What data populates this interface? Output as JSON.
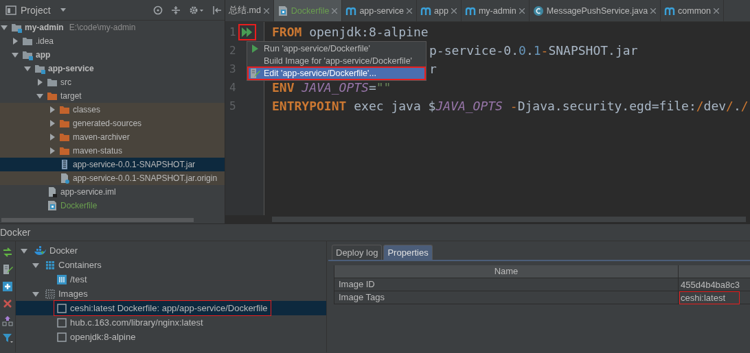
{
  "project_panel": {
    "title": "Project",
    "tree": [
      {
        "label": "my-admin",
        "kind": "module",
        "path": "E:\\code\\my-admin",
        "expanded": true,
        "selected": false,
        "children": [
          {
            "label": ".idea",
            "kind": "folder",
            "expanded": false,
            "selected": false
          },
          {
            "label": "app",
            "kind": "module",
            "expanded": true,
            "selected": false,
            "children": [
              {
                "label": "app-service",
                "kind": "module",
                "expanded": true,
                "selected": false,
                "children": [
                  {
                    "label": "src",
                    "kind": "folder",
                    "expanded": false,
                    "selected": false
                  },
                  {
                    "label": "target",
                    "kind": "excluded-folder",
                    "expanded": true,
                    "selected": false,
                    "children": [
                      {
                        "label": "classes",
                        "kind": "excluded-folder",
                        "expanded": false,
                        "selected": false
                      },
                      {
                        "label": "generated-sources",
                        "kind": "excluded-folder",
                        "expanded": false,
                        "selected": false
                      },
                      {
                        "label": "maven-archiver",
                        "kind": "excluded-folder",
                        "expanded": false,
                        "selected": false
                      },
                      {
                        "label": "maven-status",
                        "kind": "excluded-folder",
                        "expanded": false,
                        "selected": false
                      },
                      {
                        "label": "app-service-0.0.1-SNAPSHOT.jar",
                        "kind": "jar",
                        "selected": true
                      },
                      {
                        "label": "app-service-0.0.1-SNAPSHOT.jar.origin",
                        "kind": "unknown",
                        "selected": false
                      }
                    ]
                  },
                  {
                    "label": "app-service.iml",
                    "kind": "iml",
                    "selected": false
                  },
                  {
                    "label": "Dockerfile",
                    "kind": "dockerfile",
                    "selected": false
                  }
                ]
              }
            ]
          }
        ]
      }
    ]
  },
  "editor": {
    "tabs": [
      {
        "label": "总结.md",
        "kind": "markdown",
        "selected": false
      },
      {
        "label": "Dockerfile",
        "kind": "dockerfile",
        "selected": true
      },
      {
        "label": "app-service",
        "kind": "maven",
        "selected": false
      },
      {
        "label": "app",
        "kind": "maven",
        "selected": false
      },
      {
        "label": "my-admin",
        "kind": "maven",
        "selected": false
      },
      {
        "label": "MessagePushService.java",
        "kind": "class",
        "selected": false
      },
      {
        "label": "common",
        "kind": "maven",
        "selected": false
      }
    ],
    "run_gutter": {
      "highlighted": true
    },
    "lines": [
      {
        "number": "1",
        "kind": "full",
        "tokens": [
          {
            "text": "FROM",
            "kind": "keyword"
          },
          {
            "text": " openjdk:8-alpine",
            "kind": "plain"
          }
        ]
      },
      {
        "number": "2",
        "kind": "partial",
        "tokens": [
          {
            "text": "p-service-0.",
            "kind": "plain"
          },
          {
            "text": "0",
            "kind": "number"
          },
          {
            "text": ".",
            "kind": "plain"
          },
          {
            "text": "1",
            "kind": "number"
          },
          {
            "text": "-",
            "kind": "operator"
          },
          {
            "text": "SNAPSHOT.jar",
            "kind": "plain"
          }
        ]
      },
      {
        "number": "3",
        "kind": "partial",
        "tokens": [
          {
            "text": "r",
            "kind": "plain"
          }
        ]
      },
      {
        "number": "4",
        "kind": "full",
        "tokens": [
          {
            "text": "ENV ",
            "kind": "keyword"
          },
          {
            "text": "JAVA_OPTS",
            "kind": "variable"
          },
          {
            "text": "=",
            "kind": "plain"
          },
          {
            "text": "\"\"",
            "kind": "string"
          }
        ]
      },
      {
        "number": "5",
        "kind": "full",
        "tokens": [
          {
            "text": "ENTRYPOINT",
            "kind": "keyword"
          },
          {
            "text": " exec java $",
            "kind": "plain"
          },
          {
            "text": "JAVA_OPTS",
            "kind": "variable"
          },
          {
            "text": " -",
            "kind": "operator"
          },
          {
            "text": "Djava.security.egd=file:",
            "kind": "plain"
          },
          {
            "text": "/",
            "kind": "operator"
          },
          {
            "text": "dev",
            "kind": "plain"
          },
          {
            "text": "/",
            "kind": "operator"
          },
          {
            "text": ".",
            "kind": "plain"
          },
          {
            "text": "/",
            "kind": "operator"
          }
        ]
      }
    ],
    "context_menu": [
      {
        "label": "Run 'app-service/Dockerfile'",
        "kind": "run",
        "selected": false,
        "highlighted": false
      },
      {
        "label": "Build Image for 'app-service/Dockerfile'",
        "kind": "build",
        "selected": false,
        "highlighted": false
      },
      {
        "label": "Edit 'app-service/Dockerfile'...",
        "kind": "edit",
        "selected": true,
        "highlighted": true
      }
    ]
  },
  "docker_panel": {
    "title": "Docker",
    "toolbar": [
      {
        "kind": "deploy"
      },
      {
        "kind": "edit"
      },
      {
        "kind": "add"
      },
      {
        "kind": "delete"
      },
      {
        "kind": "push"
      },
      {
        "kind": "filter"
      }
    ],
    "tree": [
      {
        "label": "Docker",
        "kind": "docker",
        "expanded": true,
        "selected": false,
        "children": [
          {
            "label": "Containers",
            "kind": "containers",
            "expanded": true,
            "selected": false,
            "children": [
              {
                "label": "/test",
                "kind": "container",
                "selected": false
              }
            ]
          },
          {
            "label": "Images",
            "kind": "images",
            "expanded": true,
            "selected": false,
            "children": [
              {
                "label": "ceshi:latest Dockerfile: app/app-service/Dockerfile",
                "kind": "image",
                "selected": true,
                "highlighted": true
              },
              {
                "label": "hub.c.163.com/library/nginx:latest",
                "kind": "image",
                "selected": false,
                "highlighted": false
              },
              {
                "label": "openjdk:8-alpine",
                "kind": "image",
                "selected": false,
                "highlighted": false
              }
            ]
          }
        ]
      }
    ],
    "tabs": [
      {
        "label": "Deploy log",
        "selected": false
      },
      {
        "label": "Properties",
        "selected": true
      }
    ],
    "table": {
      "columns": [
        "Name"
      ],
      "rows": [
        {
          "name": "Image ID",
          "value": "455d4b4ba8c3",
          "highlighted": false
        },
        {
          "name": "Image Tags",
          "value": "ceshi:latest",
          "highlighted": true
        }
      ]
    }
  }
}
